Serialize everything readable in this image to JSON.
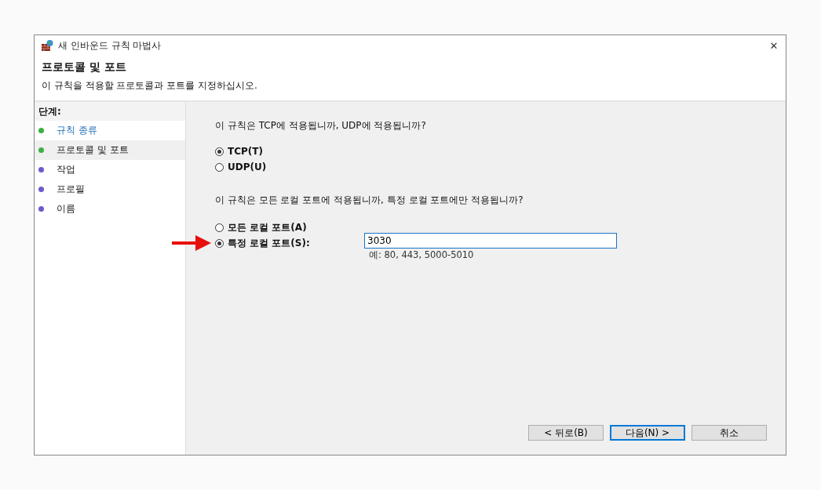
{
  "window": {
    "title": "새 인바운드 규칙 마법사",
    "close": "✕"
  },
  "header": {
    "title": "프로토콜 및 포트",
    "subtitle": "이 규칙을 적용할 프로토콜과 포트를 지정하십시오."
  },
  "steps": {
    "heading": "단계:",
    "items": [
      {
        "label": "규칙 종류",
        "color": "#3cb043",
        "selected": false,
        "link": true
      },
      {
        "label": "프로토콜 및 포트",
        "color": "#3cb043",
        "selected": true,
        "link": false
      },
      {
        "label": "작업",
        "color": "#6a5acd",
        "selected": false,
        "link": false
      },
      {
        "label": "프로필",
        "color": "#6a5acd",
        "selected": false,
        "link": false
      },
      {
        "label": "이름",
        "color": "#6a5acd",
        "selected": false,
        "link": false
      }
    ]
  },
  "protocol": {
    "question": "이 규칙은 TCP에 적용됩니까, UDP에 적용됩니까?",
    "options": [
      {
        "label": "TCP(T)",
        "selected": true
      },
      {
        "label": "UDP(U)",
        "selected": false
      }
    ]
  },
  "ports": {
    "question": "이 규칙은 모든 로컬 포트에 적용됩니까, 특정 로컬 포트에만 적용됩니까?",
    "options": [
      {
        "label": "모든 로컬 포트(A)",
        "selected": false
      },
      {
        "label": "특정 로컬 포트(S):",
        "selected": true
      }
    ],
    "value": "3030",
    "example": "예: 80, 443, 5000-5010"
  },
  "buttons": [
    {
      "label": "< 뒤로(B)",
      "default": false
    },
    {
      "label": "다음(N) >",
      "default": true
    },
    {
      "label": "취소",
      "default": false
    }
  ]
}
